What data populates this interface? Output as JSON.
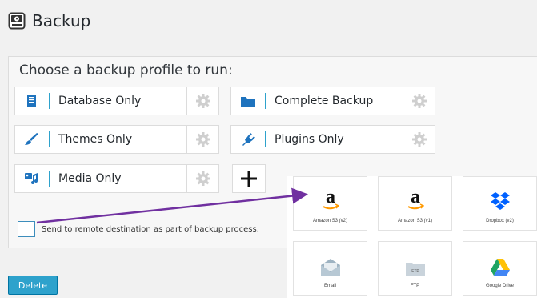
{
  "header": {
    "title": "Backup",
    "icon": "backup-disk-icon"
  },
  "choose_label": "Choose a backup profile to run:",
  "profiles": [
    {
      "label": "Database Only",
      "icon": "database-icon"
    },
    {
      "label": "Complete Backup",
      "icon": "folder-icon"
    },
    {
      "label": "Themes Only",
      "icon": "paintbrush-icon"
    },
    {
      "label": "Plugins Only",
      "icon": "plugin-icon"
    },
    {
      "label": "Media Only",
      "icon": "media-icon"
    }
  ],
  "add_button_icon": "plus-icon",
  "remote_checkbox": {
    "label": "Send to remote destination as part of backup process.",
    "checked": false
  },
  "delete_button": "Delete",
  "destinations": [
    {
      "label": "Amazon S3 (v2)",
      "icon": "amazon-icon"
    },
    {
      "label": "Amazon S3 (v1)",
      "icon": "amazon-icon"
    },
    {
      "label": "Dropbox (v2)",
      "icon": "dropbox-icon"
    },
    {
      "label": "Email",
      "icon": "email-icon"
    },
    {
      "label": "FTP",
      "icon": "ftp-icon"
    },
    {
      "label": "Google Drive",
      "icon": "google-drive-icon"
    }
  ],
  "colors": {
    "accent": "#2ea2cc",
    "arrow": "#7030a0",
    "icon_blue": "#1e73be"
  }
}
